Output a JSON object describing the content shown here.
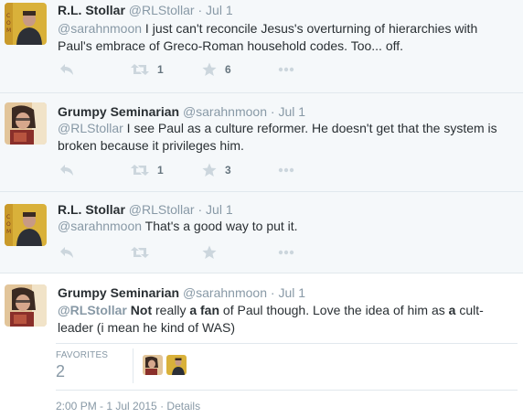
{
  "tweets": [
    {
      "name": "R.L. Stollar",
      "handle": "@RLStollar",
      "dot": "·",
      "date": "Jul 1",
      "mention": "@sarahnmoon",
      "text": " I just can't reconcile Jesus's overturning of hierarchies with Paul's embrace of Greco-Roman household codes. Too... off.",
      "retweets": "1",
      "favorites": "6"
    },
    {
      "name": "Grumpy Seminarian",
      "handle": "@sarahnmoon",
      "dot": "·",
      "date": "Jul 1",
      "mention": "@RLStollar",
      "text": " I see Paul as a culture reformer. He doesn't get that the system is broken because it privileges him.",
      "retweets": "1",
      "favorites": "3"
    },
    {
      "name": "R.L. Stollar",
      "handle": "@RLStollar",
      "dot": "·",
      "date": "Jul 1",
      "mention": "@sarahnmoon",
      "text": " That's a good way to put it."
    },
    {
      "name": "Grumpy Seminarian",
      "handle": "@sarahnmoon",
      "dot": "·",
      "date": "Jul 1",
      "mention": "@RLStollar",
      "t1": " ",
      "b1": "Not",
      "t2": " really ",
      "b2": "a fan",
      "t3": " of Paul though. Love the idea of him as ",
      "b3": "a",
      "t4": " cult-leader (i mean he kind of WAS)"
    }
  ],
  "favorites_section": {
    "label": "FAVORITES",
    "count": "2"
  },
  "footer": {
    "timestamp": "2:00 PM - 1 Jul 2015",
    "dot": "·",
    "details": "Details"
  },
  "colors": {
    "name": "#292f33",
    "muted": "#8899a6",
    "icon": "#ccd6dd",
    "grey_bg": "#f5f8fa",
    "border": "#e1e8ed"
  },
  "icons": {
    "reply": "reply-icon",
    "retweet": "retweet-icon",
    "favorite": "star-icon",
    "more": "more-dots-icon"
  }
}
